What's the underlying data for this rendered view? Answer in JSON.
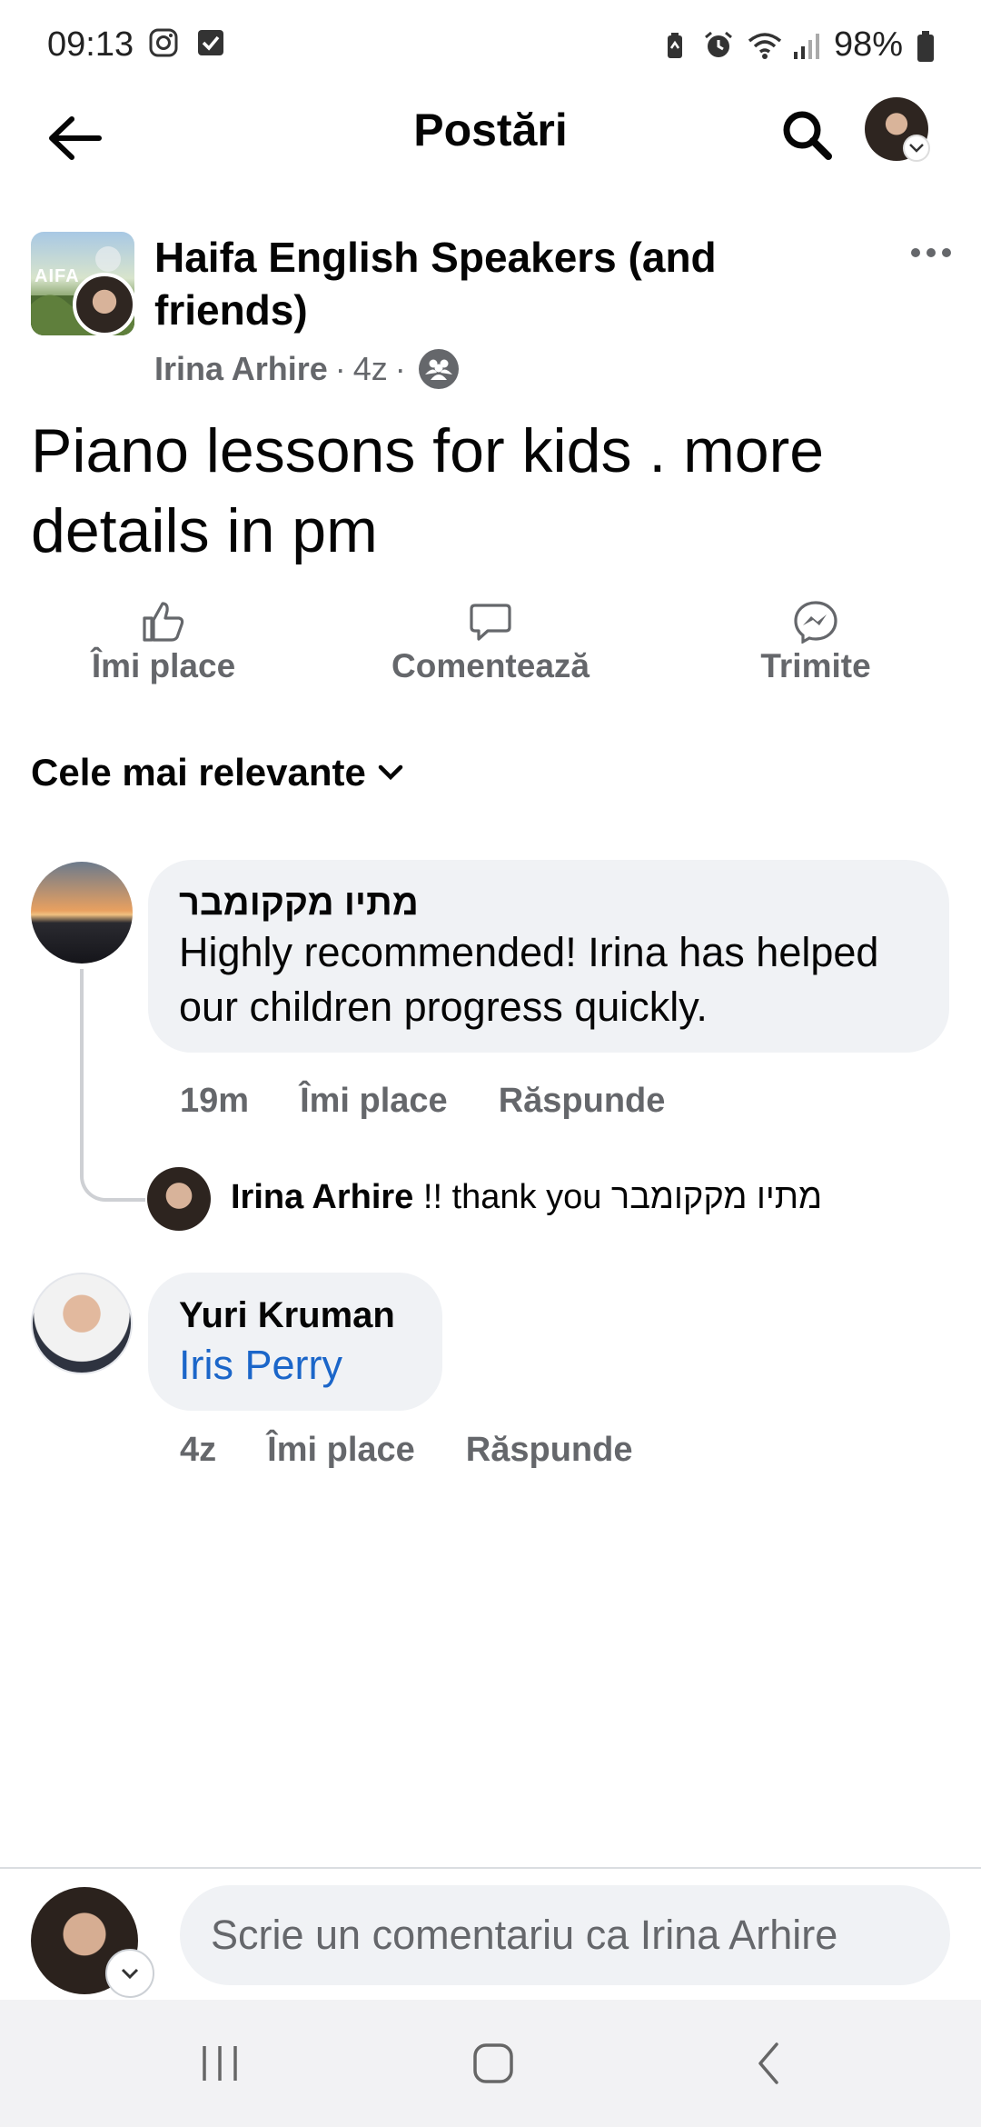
{
  "status_bar": {
    "time": "09:13",
    "battery_pct": "98%",
    "icons": [
      "instagram-icon",
      "check-icon",
      "battery-saver-icon",
      "alarm-icon",
      "wifi-icon",
      "signal-icon",
      "battery-icon"
    ]
  },
  "header": {
    "title": "Postări",
    "back_icon": "arrow-left-icon",
    "search_icon": "search-icon"
  },
  "post": {
    "group_name": "Haifa English Speakers (and friends)",
    "group_thumb_text": "AIFA",
    "author": "Irina Arhire",
    "time": "4z",
    "separator": "·",
    "audience_icon": "group-icon",
    "text": "Piano lessons for kids . more details in pm"
  },
  "actions": {
    "like": "Îmi place",
    "comment": "Comentează",
    "send": "Trimite"
  },
  "sort": {
    "label": "Cele mai relevante"
  },
  "comments": [
    {
      "name": "מתיו מקקומבר",
      "text": "Highly recommended!  Irina has helped our children progress quickly.",
      "time": "19m",
      "like": "Îmi place",
      "reply": "Răspunde"
    },
    {
      "name": "Yuri Kruman",
      "tag": "Iris Perry",
      "time": "4z",
      "like": "Îmi place",
      "reply": "Răspunde"
    }
  ],
  "reply": {
    "name": "Irina Arhire",
    "text": "!! thank you מתיו מקקומבר"
  },
  "composer": {
    "placeholder": "Scrie un comentariu ca Irina Arhire"
  },
  "colors": {
    "text_primary": "#050505",
    "text_secondary": "#65676b",
    "bubble_bg": "#f0f2f5",
    "link_blue": "#1b66c9"
  }
}
